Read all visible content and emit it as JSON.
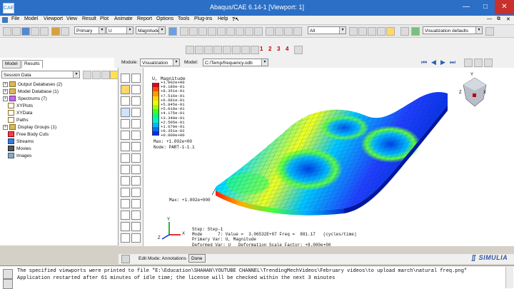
{
  "window": {
    "title": "Abaqus/CAE 6.14-1 [Viewport: 1]",
    "app_icon_text": "CAE"
  },
  "menu": {
    "items": [
      "File",
      "Model",
      "Viewport",
      "View",
      "Result",
      "Plot",
      "Animate",
      "Report",
      "Options",
      "Tools",
      "Plug-ins",
      "Help"
    ],
    "help_glyph": "?",
    "help_arrow": "↖"
  },
  "toolbar": {
    "primary_combo": "Primary",
    "variable_combo": "U",
    "invariant_combo": "Magnitude",
    "select_all_combo": "All",
    "visualization_combo": "Visualization defaults",
    "view_numbers": [
      "1",
      "2",
      "3",
      "4"
    ]
  },
  "context": {
    "module_label": "Module:",
    "module_value": "Visualization",
    "model_label": "Model:",
    "model_value": "C:/Temp/frequency.odb"
  },
  "left_panel": {
    "tabs": [
      "Model",
      "Results"
    ],
    "active_tab": "Results",
    "session_combo": "Session Data",
    "tree": [
      {
        "label": "Output Databases (2)",
        "expander": "+"
      },
      {
        "label": "Model Database (1)",
        "expander": "+"
      },
      {
        "label": "Spectrums (7)",
        "expander": "+"
      },
      {
        "label": "XYPlots",
        "expander": ""
      },
      {
        "label": "XYData",
        "expander": ""
      },
      {
        "label": "Paths",
        "expander": ""
      },
      {
        "label": "Display Groups (1)",
        "expander": "+"
      },
      {
        "label": "Free Body Cuts",
        "expander": ""
      },
      {
        "label": "Streams",
        "expander": ""
      },
      {
        "label": "Movies",
        "expander": ""
      },
      {
        "label": "Images",
        "expander": ""
      }
    ]
  },
  "legend": {
    "title": "U, Magnitude",
    "values": [
      "+1.002e+00",
      "+9.186e-01",
      "+8.351e-01",
      "+7.516e-01",
      "+6.681e-01",
      "+5.845e-01",
      "+5.010e-01",
      "+4.175e-01",
      "+3.340e-01",
      "+2.505e-01",
      "+1.670e-01",
      "+8.351e-02",
      "+0.000e+00"
    ],
    "colors": [
      "#e8001a",
      "#ff4d00",
      "#ff9a00",
      "#ffd400",
      "#e6ff00",
      "#9cff00",
      "#40ff20",
      "#00ff80",
      "#00f0d0",
      "#00b8ff",
      "#0070ff",
      "#0030e8",
      "#0000c0"
    ],
    "max_line": "Max: +1.002e+00",
    "node_line": "Node: PART-1-1.1"
  },
  "max_annotation": "Max: +1.002e+000",
  "triad": {
    "x": "X",
    "y": "Y",
    "z": "Z"
  },
  "view_cube": {
    "x": "X",
    "y": "Y",
    "z": "Z"
  },
  "step_info": {
    "line1": "Step: Step-1",
    "line2": "Mode      7: Value =  3.06532E+07 Freq =  881.17   (cycles/time)",
    "line3": "Primary Var: U, Magnitude",
    "line4": "Deformed Var: U   Deformation Scale Factor: +8.000e+00"
  },
  "prompt": {
    "text": "Edit Mode: Annotations",
    "done_label": "Done"
  },
  "brand": {
    "logo_text": "SIMULIA"
  },
  "messages": [
    "The specified viewports were printed to file \"E:\\Education\\SHAHAN\\YOUTUBE CHANNEL\\TrendingMechVideos\\February videos\\to upload march\\natural freq.png\"",
    "Application restarted after 61 minutes of idle time; the license will be checked within the next 3 minutes"
  ]
}
